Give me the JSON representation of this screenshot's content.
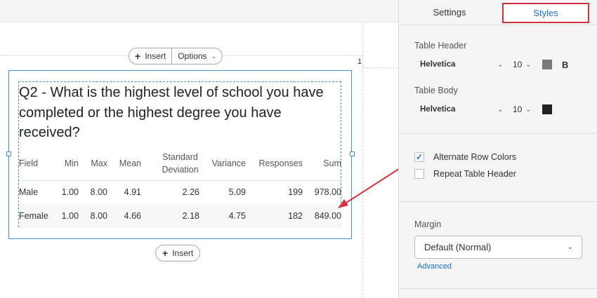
{
  "canvas": {
    "insert_label": "Insert",
    "options_label": "Options",
    "page_number": "1",
    "bottom_insert_label": "Insert"
  },
  "question": {
    "text": "Q2 - What is the highest level of school you have completed or the highest degree you have received?"
  },
  "table": {
    "headers": [
      "Field",
      "Min",
      "Max",
      "Mean",
      "Standard Deviation",
      "Variance",
      "Responses",
      "Sum"
    ],
    "rows": [
      [
        "Male",
        "1.00",
        "8.00",
        "4.91",
        "2.26",
        "5.09",
        "199",
        "978.00"
      ],
      [
        "Female",
        "1.00",
        "8.00",
        "4.66",
        "2.18",
        "4.75",
        "182",
        "849.00"
      ]
    ]
  },
  "panel": {
    "tabs": {
      "settings": "Settings",
      "styles": "Styles"
    },
    "table_header": {
      "label": "Table Header",
      "font": "Helvetica",
      "size": "10",
      "color": "#7a7a7a",
      "bold": "B"
    },
    "table_body": {
      "label": "Table Body",
      "font": "Helvetica",
      "size": "10",
      "color": "#222222"
    },
    "options": {
      "alternate_rows": {
        "label": "Alternate Row Colors",
        "checked": true
      },
      "repeat_header": {
        "label": "Repeat Table Header",
        "checked": false
      }
    },
    "margin": {
      "label": "Margin",
      "value": "Default (Normal)",
      "advanced": "Advanced"
    }
  },
  "colors": {
    "accent": "#1d6fc7",
    "highlight": "#d0333f",
    "selection": "#4a90d9"
  }
}
